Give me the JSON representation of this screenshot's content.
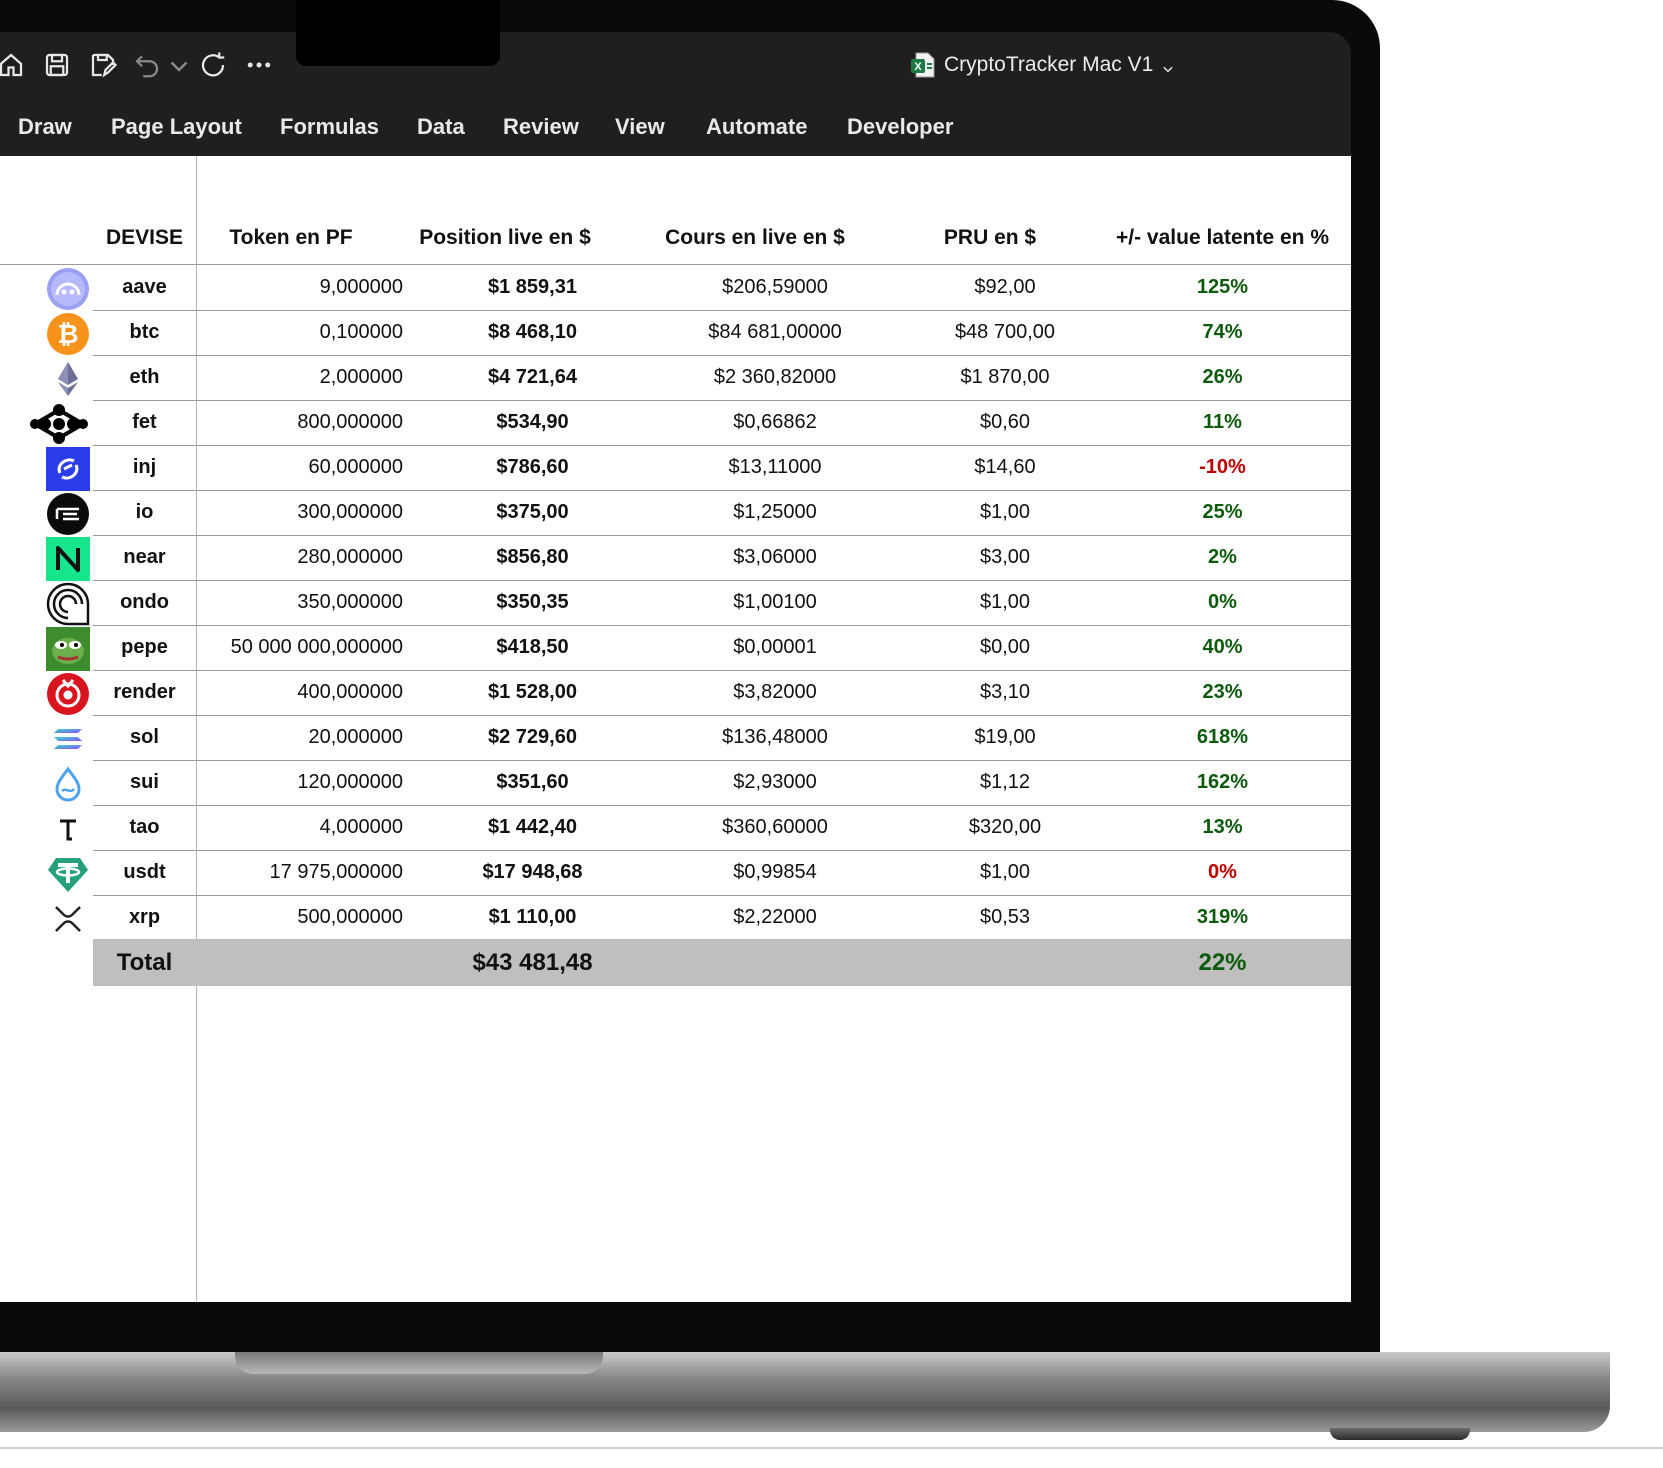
{
  "window": {
    "document_title": "CryptoTracker Mac V1"
  },
  "ribbon": {
    "tabs": [
      "Draw",
      "Page Layout",
      "Formulas",
      "Data",
      "Review",
      "View",
      "Automate",
      "Developer"
    ]
  },
  "table": {
    "headers": {
      "devise": "DEVISE",
      "token": "Token en PF",
      "position": "Position live en $",
      "cours": "Cours en live en $",
      "pru": "PRU en $",
      "pct": "+/- value latente en %"
    },
    "rows": [
      {
        "devise": "aave",
        "token": "9,000000",
        "position": "$1 859,31",
        "cours": "$206,59000",
        "pru": "$92,00",
        "pct": "125%",
        "negative": false
      },
      {
        "devise": "btc",
        "token": "0,100000",
        "position": "$8 468,10",
        "cours": "$84 681,00000",
        "pru": "$48 700,00",
        "pct": "74%",
        "negative": false
      },
      {
        "devise": "eth",
        "token": "2,000000",
        "position": "$4 721,64",
        "cours": "$2 360,82000",
        "pru": "$1 870,00",
        "pct": "26%",
        "negative": false
      },
      {
        "devise": "fet",
        "token": "800,000000",
        "position": "$534,90",
        "cours": "$0,66862",
        "pru": "$0,60",
        "pct": "11%",
        "negative": false
      },
      {
        "devise": "inj",
        "token": "60,000000",
        "position": "$786,60",
        "cours": "$13,11000",
        "pru": "$14,60",
        "pct": "-10%",
        "negative": true
      },
      {
        "devise": "io",
        "token": "300,000000",
        "position": "$375,00",
        "cours": "$1,25000",
        "pru": "$1,00",
        "pct": "25%",
        "negative": false
      },
      {
        "devise": "near",
        "token": "280,000000",
        "position": "$856,80",
        "cours": "$3,06000",
        "pru": "$3,00",
        "pct": "2%",
        "negative": false
      },
      {
        "devise": "ondo",
        "token": "350,000000",
        "position": "$350,35",
        "cours": "$1,00100",
        "pru": "$1,00",
        "pct": "0%",
        "negative": false
      },
      {
        "devise": "pepe",
        "token": "50 000 000,000000",
        "position": "$418,50",
        "cours": "$0,00001",
        "pru": "$0,00",
        "pct": "40%",
        "negative": false
      },
      {
        "devise": "render",
        "token": "400,000000",
        "position": "$1 528,00",
        "cours": "$3,82000",
        "pru": "$3,10",
        "pct": "23%",
        "negative": false
      },
      {
        "devise": "sol",
        "token": "20,000000",
        "position": "$2 729,60",
        "cours": "$136,48000",
        "pru": "$19,00",
        "pct": "618%",
        "negative": false
      },
      {
        "devise": "sui",
        "token": "120,000000",
        "position": "$351,60",
        "cours": "$2,93000",
        "pru": "$1,12",
        "pct": "162%",
        "negative": false
      },
      {
        "devise": "tao",
        "token": "4,000000",
        "position": "$1 442,40",
        "cours": "$360,60000",
        "pru": "$320,00",
        "pct": "13%",
        "negative": false
      },
      {
        "devise": "usdt",
        "token": "17 975,000000",
        "position": "$17 948,68",
        "cours": "$0,99854",
        "pru": "$1,00",
        "pct": "0%",
        "negative": true
      },
      {
        "devise": "xrp",
        "token": "500,000000",
        "position": "$1 110,00",
        "cours": "$2,22000",
        "pru": "$0,53",
        "pct": "319%",
        "negative": false
      }
    ],
    "total": {
      "label": "Total",
      "position": "$43 481,48",
      "pct": "22%"
    }
  },
  "colors": {
    "positive": "#0c5a0c",
    "negative": "#c00000",
    "total_row_bg": "#bfbfbf"
  }
}
